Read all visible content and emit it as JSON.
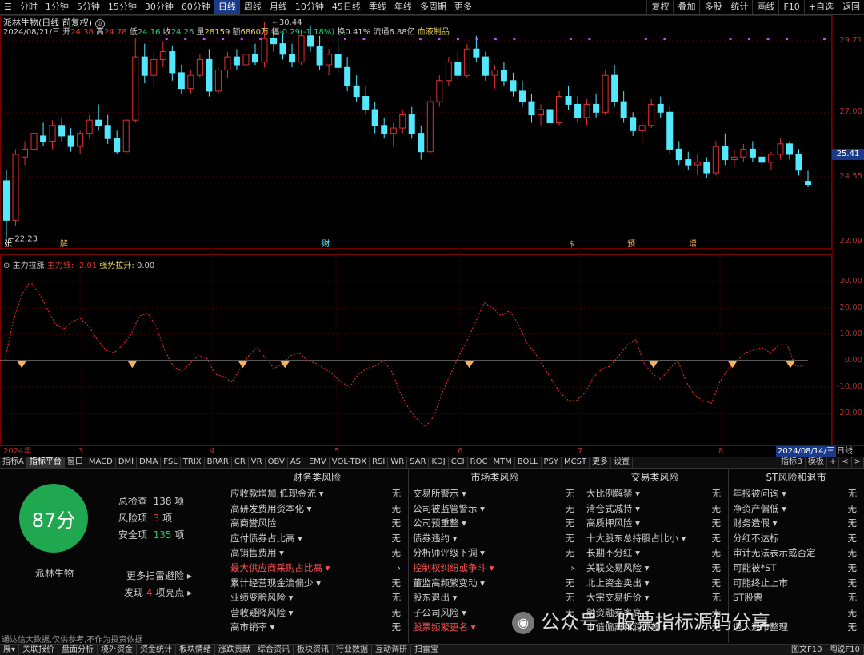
{
  "toolbar": {
    "periods": [
      "分时",
      "1分钟",
      "5分钟",
      "15分钟",
      "30分钟",
      "60分钟",
      "日线",
      "周线",
      "月线",
      "10分钟",
      "45日线",
      "季线",
      "年线",
      "多周期",
      "更多"
    ],
    "active_period": "日线",
    "right_buttons": [
      "复权",
      "叠加",
      "多股",
      "统计",
      "画线",
      "F10",
      "+自选",
      "返回"
    ]
  },
  "stock": {
    "title": "派林生物(日线 前复权)",
    "info": {
      "date": "2024/08/21/三",
      "open_label": "开",
      "open": "24.38",
      "high_label": "高",
      "high": "24.78",
      "low_label": "低",
      "low": "24.16",
      "close_label": "收",
      "close": "24.26",
      "vol_label": "量",
      "vol": "28159",
      "amount_label": "额",
      "amount": "6860万",
      "chg_label": "幅",
      "chg": "-0.29(-1.18%)",
      "turnover_label": "换",
      "turnover": "0.41%",
      "float_label": "流通",
      "float": "6.88亿",
      "sector": "血液制品"
    }
  },
  "price_axis": {
    "labels": [
      "29.71",
      "27.00",
      "24.55",
      "22.09"
    ],
    "current": "25.41",
    "high_mark": "30.44",
    "low_mark": "22.23"
  },
  "event_marks": [
    "张",
    "解",
    "财",
    "$",
    "预",
    "增"
  ],
  "indicator": {
    "name": "主力拉涨",
    "line1_label": "主力线:",
    "line1_value": "-2.01",
    "line2_label": "强势拉升:",
    "line2_value": "0.00",
    "axis_labels": [
      "30.00",
      "20.00",
      "10.00",
      "0.00",
      "-10.00",
      "-20.00"
    ]
  },
  "chart_data": {
    "type": "candlestick",
    "ohlc": [
      [
        24.4,
        24.8,
        22.23,
        22.9
      ],
      [
        22.9,
        25.6,
        22.7,
        25.4
      ],
      [
        25.3,
        25.9,
        25.0,
        25.6
      ],
      [
        25.6,
        26.4,
        25.3,
        26.2
      ],
      [
        26.1,
        26.6,
        25.7,
        25.9
      ],
      [
        25.9,
        26.7,
        25.6,
        26.5
      ],
      [
        26.5,
        26.8,
        25.9,
        26.1
      ],
      [
        26.1,
        26.4,
        25.5,
        25.7
      ],
      [
        25.7,
        26.3,
        25.4,
        26.2
      ],
      [
        26.2,
        26.9,
        26.0,
        26.7
      ],
      [
        26.7,
        27.3,
        26.3,
        26.5
      ],
      [
        26.5,
        26.9,
        25.8,
        26.0
      ],
      [
        26.0,
        26.3,
        25.4,
        25.5
      ],
      [
        25.5,
        26.8,
        25.4,
        26.7
      ],
      [
        26.7,
        29.8,
        26.6,
        29.1
      ],
      [
        29.1,
        29.6,
        28.1,
        28.4
      ],
      [
        28.4,
        29.3,
        28.0,
        29.0
      ],
      [
        29.0,
        29.7,
        28.7,
        29.3
      ],
      [
        29.3,
        29.5,
        28.2,
        28.5
      ],
      [
        28.5,
        28.8,
        27.7,
        27.9
      ],
      [
        27.9,
        28.6,
        27.7,
        28.4
      ],
      [
        28.4,
        29.2,
        28.3,
        29.0
      ],
      [
        29.0,
        29.4,
        27.6,
        27.8
      ],
      [
        27.8,
        28.7,
        27.7,
        28.6
      ],
      [
        28.6,
        29.3,
        28.3,
        29.1
      ],
      [
        29.1,
        29.4,
        28.6,
        28.8
      ],
      [
        28.8,
        29.3,
        28.6,
        29.2
      ],
      [
        29.2,
        29.6,
        28.8,
        28.9
      ],
      [
        28.9,
        30.44,
        28.7,
        29.8
      ],
      [
        29.8,
        30.1,
        29.3,
        29.6
      ],
      [
        29.6,
        30.0,
        29.0,
        29.2
      ],
      [
        29.2,
        29.6,
        28.7,
        28.9
      ],
      [
        28.9,
        30.1,
        28.8,
        29.9
      ],
      [
        29.9,
        30.3,
        29.3,
        29.5
      ],
      [
        29.5,
        29.9,
        28.6,
        28.8
      ],
      [
        28.8,
        29.4,
        28.4,
        29.2
      ],
      [
        29.2,
        29.8,
        28.5,
        28.7
      ],
      [
        28.7,
        29.1,
        27.8,
        28.0
      ],
      [
        28.0,
        28.4,
        27.4,
        27.6
      ],
      [
        27.6,
        28.0,
        26.9,
        27.1
      ],
      [
        27.1,
        27.4,
        26.2,
        26.5
      ],
      [
        26.5,
        26.8,
        26.0,
        26.2
      ],
      [
        26.2,
        26.6,
        25.7,
        26.4
      ],
      [
        26.4,
        27.1,
        26.2,
        26.9
      ],
      [
        26.9,
        27.2,
        26.0,
        26.2
      ],
      [
        26.2,
        26.5,
        25.2,
        25.5
      ],
      [
        25.5,
        27.6,
        25.4,
        27.4
      ],
      [
        27.4,
        28.4,
        27.2,
        28.2
      ],
      [
        28.2,
        29.1,
        28.0,
        28.9
      ],
      [
        28.9,
        29.3,
        28.2,
        28.4
      ],
      [
        28.4,
        29.6,
        28.3,
        29.4
      ],
      [
        29.4,
        29.9,
        28.9,
        29.1
      ],
      [
        29.1,
        29.3,
        28.2,
        28.4
      ],
      [
        28.4,
        28.8,
        27.9,
        28.6
      ],
      [
        28.6,
        28.9,
        28.0,
        28.2
      ],
      [
        28.2,
        28.5,
        27.6,
        27.8
      ],
      [
        27.8,
        28.2,
        27.2,
        27.4
      ],
      [
        27.4,
        27.7,
        26.6,
        26.9
      ],
      [
        26.9,
        27.3,
        26.5,
        27.1
      ],
      [
        27.1,
        27.4,
        26.4,
        26.6
      ],
      [
        26.6,
        27.8,
        26.5,
        27.6
      ],
      [
        27.6,
        28.0,
        27.1,
        27.3
      ],
      [
        27.3,
        27.6,
        26.6,
        26.8
      ],
      [
        26.8,
        27.5,
        26.5,
        27.3
      ],
      [
        27.3,
        27.7,
        26.8,
        27.0
      ],
      [
        27.0,
        28.6,
        26.9,
        28.4
      ],
      [
        28.4,
        28.8,
        27.2,
        27.4
      ],
      [
        27.4,
        27.8,
        26.6,
        26.8
      ],
      [
        26.8,
        27.0,
        26.1,
        26.3
      ],
      [
        26.3,
        26.7,
        25.8,
        26.5
      ],
      [
        26.5,
        27.5,
        26.4,
        27.3
      ],
      [
        27.3,
        27.6,
        26.8,
        27.0
      ],
      [
        27.0,
        27.2,
        25.4,
        25.6
      ],
      [
        25.6,
        25.9,
        25.0,
        25.2
      ],
      [
        25.2,
        25.5,
        24.8,
        25.0
      ],
      [
        25.0,
        25.4,
        24.6,
        25.1
      ],
      [
        25.1,
        25.3,
        24.5,
        24.7
      ],
      [
        24.7,
        25.9,
        24.6,
        25.7
      ],
      [
        25.7,
        26.2,
        25.0,
        25.2
      ],
      [
        25.2,
        25.6,
        24.9,
        25.3
      ],
      [
        25.3,
        25.8,
        25.1,
        25.6
      ],
      [
        25.6,
        25.9,
        25.1,
        25.3
      ],
      [
        25.3,
        25.6,
        24.9,
        25.1
      ],
      [
        25.1,
        25.5,
        24.8,
        25.4
      ],
      [
        25.4,
        26.0,
        25.2,
        25.8
      ],
      [
        25.8,
        25.9,
        25.2,
        25.4
      ],
      [
        25.4,
        25.6,
        24.6,
        24.8
      ],
      [
        24.38,
        24.78,
        24.16,
        24.26
      ]
    ],
    "ylim": [
      22.09,
      30.44
    ],
    "indicator_series": {
      "name": "主力线",
      "values": [
        0,
        15,
        25,
        30,
        26,
        20,
        14,
        12,
        15,
        16,
        13,
        8,
        4,
        3,
        6,
        10,
        17,
        18,
        13,
        4,
        -2,
        -4,
        -1,
        2,
        1,
        -5,
        -6,
        -8,
        -3,
        2,
        5,
        1,
        -3,
        -1,
        2,
        3,
        0,
        -1,
        -3,
        -5,
        -8,
        -10,
        -5,
        -3,
        -2,
        0,
        -4,
        -12,
        -18,
        -22,
        -25,
        -21,
        -12,
        -5,
        2,
        8,
        15,
        22,
        20,
        17,
        19,
        14,
        7,
        3,
        -2,
        -7,
        -12,
        -15,
        -15,
        -12,
        -6,
        -3,
        -2,
        2,
        6,
        8,
        -1,
        -5,
        -7,
        -3,
        0,
        -8,
        -13,
        -15,
        -16,
        -8,
        -3,
        0,
        3,
        4,
        5,
        3,
        6,
        6,
        -2,
        -2.01
      ],
      "signal_markers": [
        2,
        23,
        44,
        52,
        87,
        122,
        137,
        148
      ]
    },
    "ind_ylim": [
      -32,
      40
    ]
  },
  "date_axis": [
    "2024年",
    "3",
    "4",
    "5",
    "6",
    "7",
    "8",
    "2024/08/14/三",
    "日线"
  ],
  "indicator_tabs": [
    "指标A",
    "指标平台",
    "窗口",
    "MACD",
    "DMI",
    "DMA",
    "FSL",
    "TRIX",
    "BRAR",
    "CR",
    "VR",
    "OBV",
    "ASI",
    "EMV",
    "VOL-TDX",
    "RSI",
    "WR",
    "SAR",
    "KDJ",
    "CCI",
    "ROC",
    "MTM",
    "BOLL",
    "PSY",
    "MCST",
    "更多",
    "设置"
  ],
  "indicator_tabs_right": [
    "指标B",
    "模板",
    "+",
    "<",
    ">"
  ],
  "panel": {
    "score": "87分",
    "stock_name": "派林生物",
    "total_label": "总检查",
    "total_value": "138",
    "unit": "项",
    "risk_label": "风险项",
    "risk_value": "3",
    "safe_label": "安全项",
    "safe_value": "135",
    "more_link": "更多扫雷避险 ▸",
    "find_prefix": "发现",
    "find_value": "4",
    "find_suffix": "项亮点 ▸",
    "disclaimer": "通达信大数据,仅供参考,不作为投资依据",
    "columns": [
      {
        "title": "财务类风险",
        "rows": [
          {
            "label": "应收款增加,低现金流 ▾",
            "status": "无",
            "hl": false
          },
          {
            "label": "高研发费用资本化 ▾",
            "status": "无",
            "hl": false
          },
          {
            "label": "高商誉风险",
            "status": "无",
            "hl": false
          },
          {
            "label": "应付债券占比高 ▾",
            "status": "无",
            "hl": false
          },
          {
            "label": "高销售费用 ▾",
            "status": "无",
            "hl": false
          },
          {
            "label": "最大供应商采购占比高 ▾",
            "status": "›",
            "hl": true
          },
          {
            "label": "累计经营现金流偏少 ▾",
            "status": "无",
            "hl": false
          },
          {
            "label": "业绩变脸风险 ▾",
            "status": "无",
            "hl": false
          },
          {
            "label": "营收疑降风险 ▾",
            "status": "无",
            "hl": false
          },
          {
            "label": "高市销率 ▾",
            "status": "无",
            "hl": false
          }
        ]
      },
      {
        "title": "市场类风险",
        "rows": [
          {
            "label": "交易所警示 ▾",
            "status": "无",
            "hl": false
          },
          {
            "label": "公司被监管警示 ▾",
            "status": "无",
            "hl": false
          },
          {
            "label": "公司预重整 ▾",
            "status": "无",
            "hl": false
          },
          {
            "label": "债券违约 ▾",
            "status": "无",
            "hl": false
          },
          {
            "label": "分析师评级下调 ▾",
            "status": "无",
            "hl": false
          },
          {
            "label": "控制权纠纷或争斗 ▾",
            "status": "›",
            "hl": true
          },
          {
            "label": "董监高频繁变动 ▾",
            "status": "无",
            "hl": false
          },
          {
            "label": "股东退出 ▾",
            "status": "无",
            "hl": false
          },
          {
            "label": "子公司风险 ▾",
            "status": "无",
            "hl": false
          },
          {
            "label": "股票频繁更名 ▾",
            "status": "",
            "hl": true
          }
        ]
      },
      {
        "title": "交易类风险",
        "rows": [
          {
            "label": "大比例解禁 ▾",
            "status": "无",
            "hl": false
          },
          {
            "label": "清仓式减持 ▾",
            "status": "无",
            "hl": false
          },
          {
            "label": "高质押风险 ▾",
            "status": "无",
            "hl": false
          },
          {
            "label": "十大股东总持股占比小 ▾",
            "status": "无",
            "hl": false
          },
          {
            "label": "长期不分红 ▾",
            "status": "无",
            "hl": false
          },
          {
            "label": "关联交易风险 ▾",
            "status": "无",
            "hl": false
          },
          {
            "label": "北上资金卖出 ▾",
            "status": "无",
            "hl": false
          },
          {
            "label": "大宗交易折价 ▾",
            "status": "无",
            "hl": false
          },
          {
            "label": "融资融券率高 ▾",
            "status": "无",
            "hl": false
          },
          {
            "label": "市值偏离和润偏差 ▾",
            "status": "无",
            "hl": false
          }
        ]
      },
      {
        "title": "ST风险和退市",
        "rows": [
          {
            "label": "年报被问询 ▾",
            "status": "无",
            "hl": false
          },
          {
            "label": "净资产偏低 ▾",
            "status": "无",
            "hl": false
          },
          {
            "label": "财务造假 ▾",
            "status": "无",
            "hl": false
          },
          {
            "label": "分红不达标",
            "status": "无",
            "hl": false
          },
          {
            "label": "审计无法表示或否定",
            "status": "无",
            "hl": false
          },
          {
            "label": "可能被*ST",
            "status": "无",
            "hl": false
          },
          {
            "label": "可能终止上市",
            "status": "无",
            "hl": false
          },
          {
            "label": "ST股票",
            "status": "无",
            "hl": false
          },
          {
            "label": "",
            "status": "无",
            "hl": false
          },
          {
            "label": "退入退市整理",
            "status": "无",
            "hl": false
          }
        ]
      }
    ]
  },
  "footer_tabs": [
    "展▾",
    "关联报价",
    "盘面分析",
    "境外资金",
    "资金统计",
    "板块情绪",
    "涨跌贡献",
    "综合资讯",
    "板块资讯",
    "行业数据",
    "互动调研",
    "扫雷宝"
  ],
  "footer_right": [
    "图文F10",
    "陶说F10"
  ],
  "watermark": "公众号 · 股票指标源码分享",
  "colors": {
    "up": "#e03030",
    "down": "#54e8ff",
    "indicator": "#d82a2a",
    "signal": "#f3b35a",
    "accent": "#1b3b8a"
  }
}
